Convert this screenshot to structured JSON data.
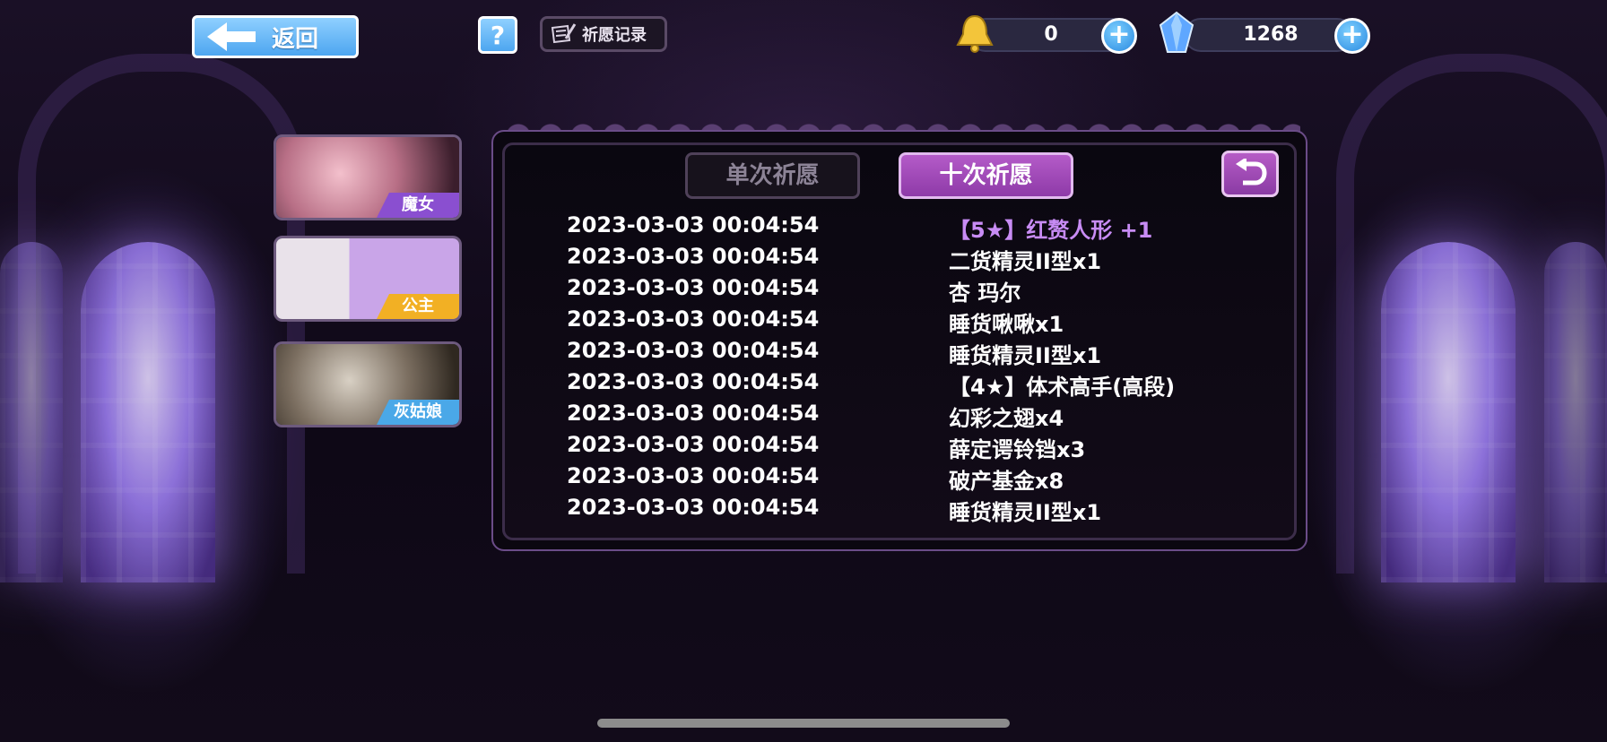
{
  "top_bar": {
    "back_label": "返回",
    "help_label": "?",
    "record_label": "祈愿记录",
    "gold_value": "0",
    "gem_value": "1268"
  },
  "side_tabs": [
    {
      "label": "魔女",
      "tag_color": "#8a4fd0"
    },
    {
      "label": "公主",
      "tag_color": "#f2b024"
    },
    {
      "label": "灰姑娘",
      "tag_color": "#4aa8e8"
    }
  ],
  "tabs": {
    "single": "单次祈愿",
    "ten": "十次祈愿",
    "active": "ten"
  },
  "records": [
    {
      "time": "2023-03-03 00:04:54",
      "item": "【5★】红赘人形 +1",
      "rare": true
    },
    {
      "time": "2023-03-03 00:04:54",
      "item": "二货精灵II型x1",
      "rare": false
    },
    {
      "time": "2023-03-03 00:04:54",
      "item": "杏 玛尔",
      "rare": false
    },
    {
      "time": "2023-03-03 00:04:54",
      "item": "睡货啾啾x1",
      "rare": false
    },
    {
      "time": "2023-03-03 00:04:54",
      "item": "睡货精灵II型x1",
      "rare": false
    },
    {
      "time": "2023-03-03 00:04:54",
      "item": "【4★】体术高手(高段)",
      "rare": false
    },
    {
      "time": "2023-03-03 00:04:54",
      "item": "幻彩之翅x4",
      "rare": false
    },
    {
      "time": "2023-03-03 00:04:54",
      "item": "薛定谔铃铛x3",
      "rare": false
    },
    {
      "time": "2023-03-03 00:04:54",
      "item": "破产基金x8",
      "rare": false
    },
    {
      "time": "2023-03-03 00:04:54",
      "item": "睡货精灵II型x1",
      "rare": false
    }
  ],
  "colors": {
    "rare_item": "#c88cf5",
    "active_tab": "#a34bbd",
    "button_blue": "#4da6f0"
  }
}
